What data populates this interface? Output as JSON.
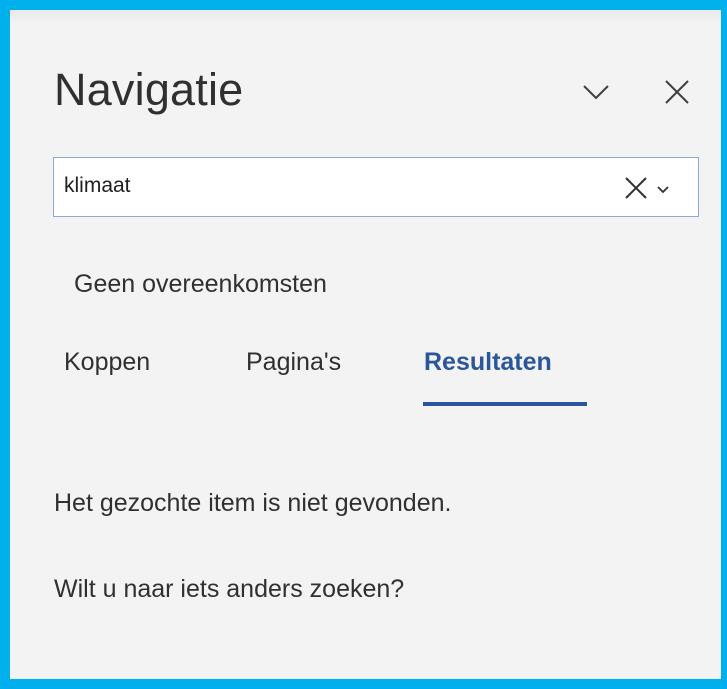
{
  "pane": {
    "title": "Navigatie",
    "menu_icon": "chevron-down-icon",
    "close_icon": "close-icon"
  },
  "search": {
    "value": "klimaat",
    "clear_icon": "close-icon",
    "options_icon": "chevron-down-icon"
  },
  "status": "Geen overeenkomsten",
  "tabs": [
    {
      "label": "Koppen"
    },
    {
      "label": "Pagina's"
    },
    {
      "label": "Resultaten",
      "active": true
    }
  ],
  "results": {
    "not_found": "Het gezochte item is niet gevonden.",
    "suggestion": "Wilt u naar iets anders zoeken?"
  },
  "colors": {
    "frame_border": "#00b0ec",
    "pane_background": "#f3f3f3",
    "accent": "#2b579a"
  }
}
